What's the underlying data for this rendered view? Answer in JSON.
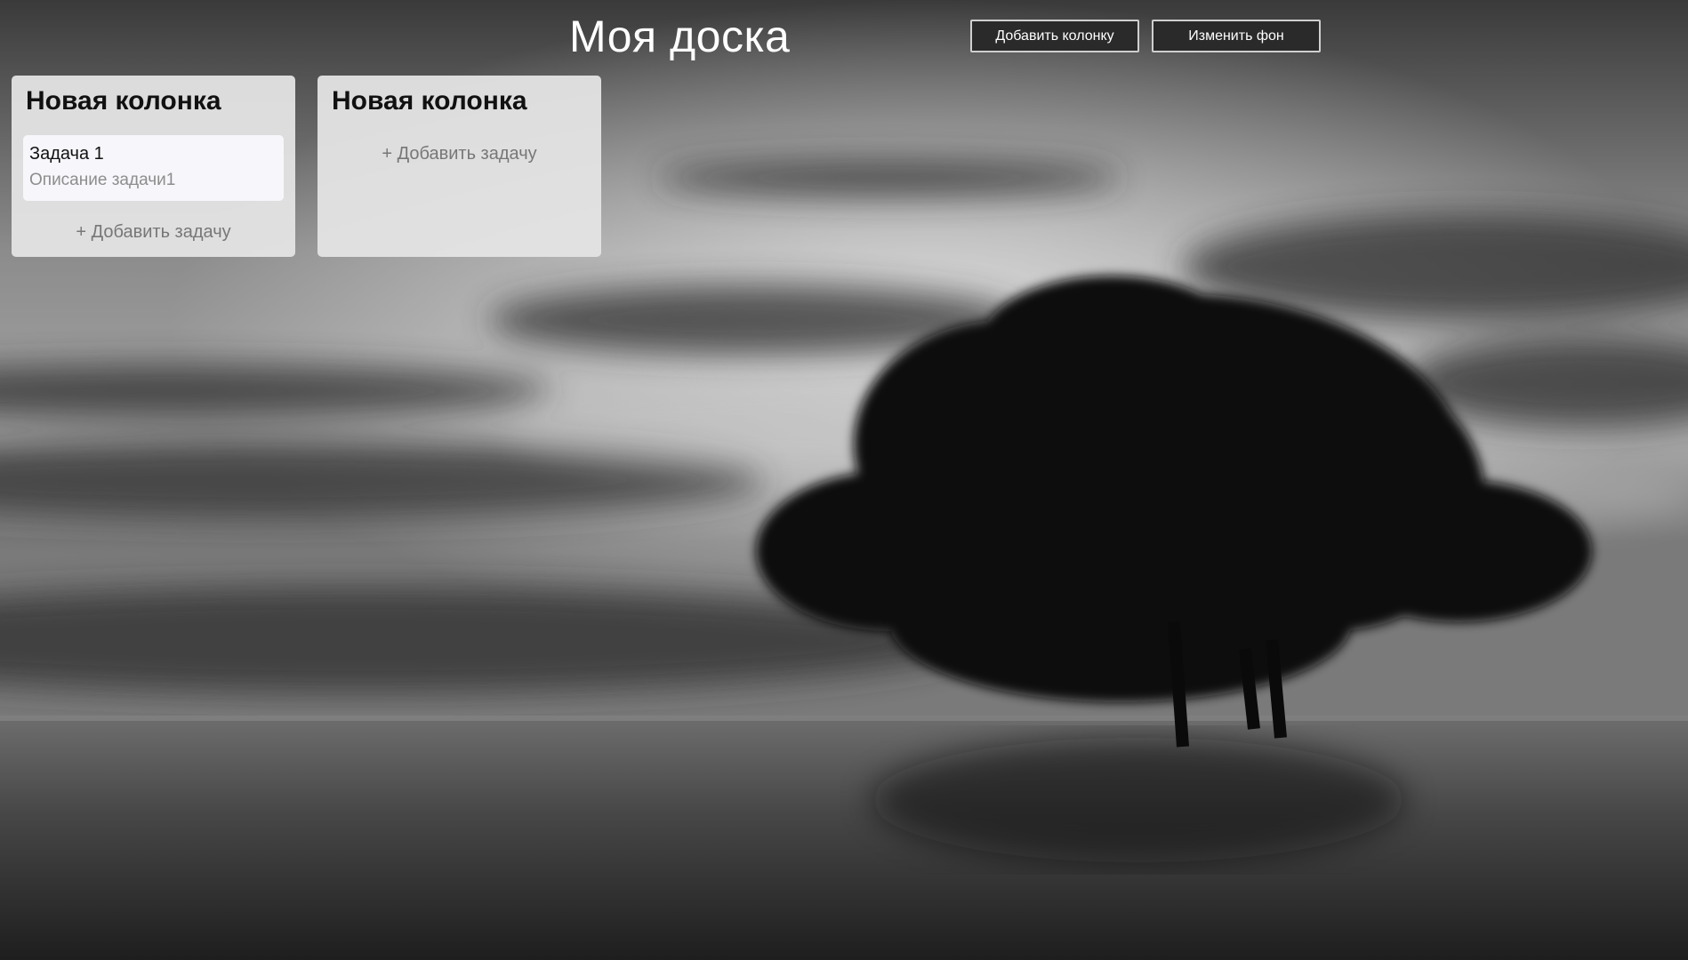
{
  "board": {
    "title": "Моя доска",
    "add_column_label": "Добавить колонку",
    "change_background_label": "Изменить фон"
  },
  "columns": [
    {
      "title": "Новая колонка",
      "tasks": [
        {
          "title": "Задача 1",
          "description": "Описание задачи1"
        }
      ],
      "add_task_label": "+ Добавить задачу"
    },
    {
      "title": "Новая колонка",
      "tasks": [],
      "add_task_label": "+ Добавить задачу"
    }
  ],
  "background": {
    "description_icon": "landscape-photo",
    "sky_color": "#8a8a8a",
    "water_color": "#3c3c3c",
    "tree_color": "#0a0a0a"
  },
  "colors": {
    "button_bg": "#2a2a2a",
    "column_bg": "#e4e4e4",
    "task_bg": "#f6f6fb"
  }
}
